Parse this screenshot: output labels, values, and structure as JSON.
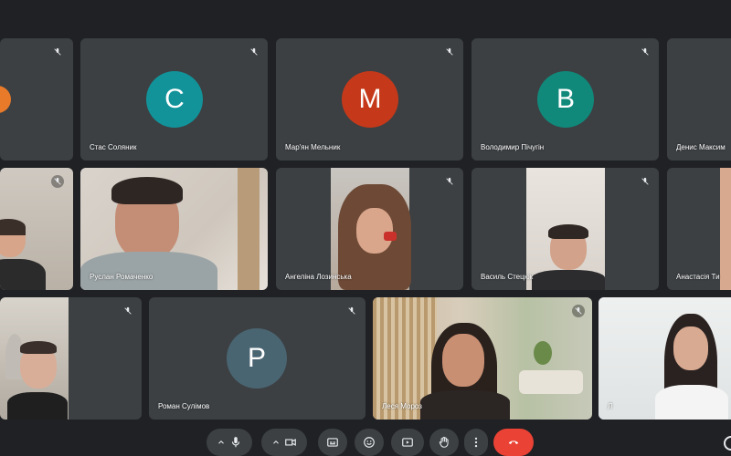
{
  "participants": [
    {
      "name": "",
      "avatar_letter": ""
    },
    {
      "name": "Стас Соляник",
      "avatar_letter": "С",
      "avatar_color": "#12939a"
    },
    {
      "name": "Мар'ян Мельник",
      "avatar_letter": "М",
      "avatar_color": "#c5391a"
    },
    {
      "name": "Володимир Пічугін",
      "avatar_letter": "В",
      "avatar_color": "#10897b"
    },
    {
      "name": "Денис Максим",
      "avatar_letter": ""
    },
    {
      "name": ""
    },
    {
      "name": "Руслан Ромаченко"
    },
    {
      "name": "Ангеліна Лозинська"
    },
    {
      "name": "Василь Стецюк"
    },
    {
      "name": "Анастасія Ти"
    },
    {
      "name": ""
    },
    {
      "name": "Роман Сулімов",
      "avatar_letter": "Р",
      "avatar_color": "#4a6572"
    },
    {
      "name": "Леся Мороз"
    },
    {
      "name": "Л"
    }
  ],
  "toolbar": {
    "buttons": [
      "more-up",
      "microphone",
      "more-up",
      "camera",
      "captions",
      "emoji",
      "present",
      "raise-hand",
      "more-options",
      "leave-call"
    ]
  }
}
